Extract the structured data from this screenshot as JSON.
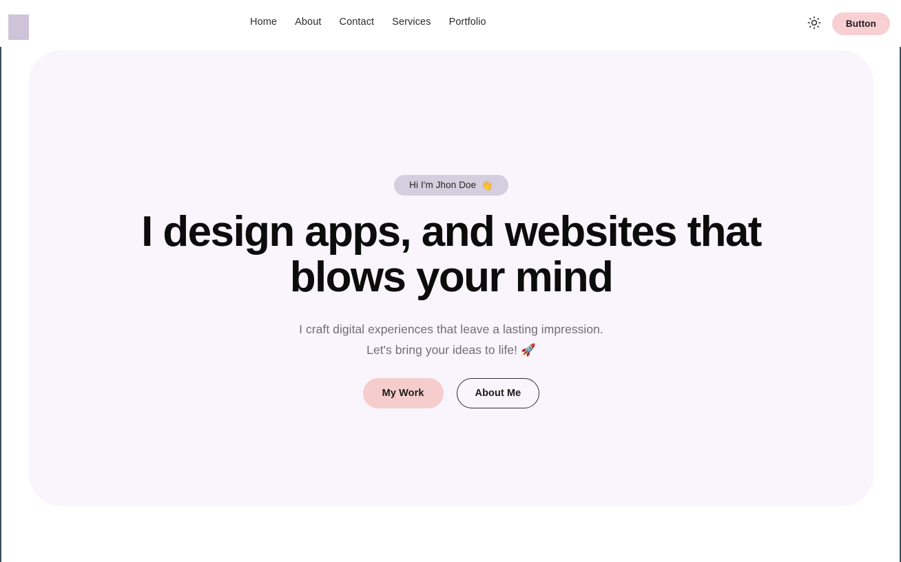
{
  "header": {
    "logo_name": "logo-mark",
    "nav": [
      {
        "label": "Home"
      },
      {
        "label": "About"
      },
      {
        "label": "Contact"
      },
      {
        "label": "Services"
      },
      {
        "label": "Portfolio"
      }
    ],
    "theme_toggle_icon": "sun-icon",
    "button_label": "Button"
  },
  "hero": {
    "badge_text": "Hi I'm Jhon Doe",
    "badge_emoji": "👋",
    "title": "I design apps, and websites that blows your mind",
    "subtitle_line1": "I craft digital experiences that leave a lasting impression.",
    "subtitle_line2": "Let's bring your ideas to life! 🚀",
    "primary_cta": "My Work",
    "secondary_cta": "About Me"
  },
  "colors": {
    "page_background": "#ffffff",
    "page_border": "#3d4f5c",
    "logo": "#cfc3d9",
    "hero_card_background": "#faf5fd",
    "badge_background": "#d5cede",
    "accent_pink": "#f6cdcd",
    "header_button": "#f8cfd3",
    "title_text": "#0c0c0c",
    "subtitle_text": "#6e6e73"
  }
}
